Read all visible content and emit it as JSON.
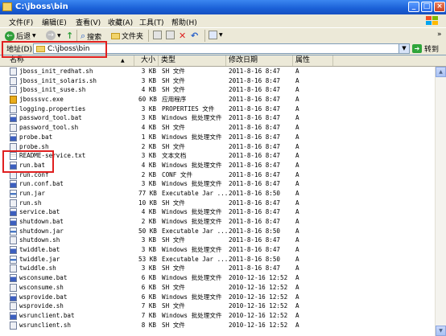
{
  "window": {
    "title": "C:\\jboss\\bin",
    "minimize_glyph": "_",
    "maximize_glyph": "□",
    "close_glyph": "×"
  },
  "menu": [
    "文件(F)",
    "编辑(E)",
    "查看(V)",
    "收藏(A)",
    "工具(T)",
    "帮助(H)"
  ],
  "toolbar": {
    "back": "后退",
    "search": "搜索",
    "folders": "文件夹",
    "forward_glyph": "»"
  },
  "address": {
    "label": "地址(D)",
    "value": "C:\\jboss\\bin",
    "go": "转到"
  },
  "columns": {
    "name": "名称",
    "name_sort_glyph": "▲",
    "size": "大小",
    "type": "类型",
    "modified": "修改日期",
    "attributes": "属性"
  },
  "files": [
    {
      "name": "jboss_init_redhat.sh",
      "size": "3 KB",
      "type": "SH 文件",
      "date": "2011-8-16 8:47",
      "attr": "A",
      "icon": "sh"
    },
    {
      "name": "jboss_init_solaris.sh",
      "size": "3 KB",
      "type": "SH 文件",
      "date": "2011-8-16 8:47",
      "attr": "A",
      "icon": "sh"
    },
    {
      "name": "jboss_init_suse.sh",
      "size": "4 KB",
      "type": "SH 文件",
      "date": "2011-8-16 8:47",
      "attr": "A",
      "icon": "sh"
    },
    {
      "name": "jbosssvc.exe",
      "size": "60 KB",
      "type": "应用程序",
      "date": "2011-8-16 8:47",
      "attr": "A",
      "icon": "exe"
    },
    {
      "name": "logging.properties",
      "size": "3 KB",
      "type": "PROPERTIES 文件",
      "date": "2011-8-16 8:47",
      "attr": "A",
      "icon": "sh"
    },
    {
      "name": "password_tool.bat",
      "size": "3 KB",
      "type": "Windows 批处理文件",
      "date": "2011-8-16 8:47",
      "attr": "A",
      "icon": "bat"
    },
    {
      "name": "password_tool.sh",
      "size": "4 KB",
      "type": "SH 文件",
      "date": "2011-8-16 8:47",
      "attr": "A",
      "icon": "sh"
    },
    {
      "name": "probe.bat",
      "size": "1 KB",
      "type": "Windows 批处理文件",
      "date": "2011-8-16 8:47",
      "attr": "A",
      "icon": "bat"
    },
    {
      "name": "probe.sh",
      "size": "2 KB",
      "type": "SH 文件",
      "date": "2011-8-16 8:47",
      "attr": "A",
      "icon": "sh"
    },
    {
      "name": "README-service.txt",
      "size": "3 KB",
      "type": "文本文档",
      "date": "2011-8-16 8:47",
      "attr": "A",
      "icon": "txt"
    },
    {
      "name": "run.bat",
      "size": "4 KB",
      "type": "Windows 批处理文件",
      "date": "2011-8-16 8:47",
      "attr": "A",
      "icon": "bat"
    },
    {
      "name": "run.conf",
      "size": "2 KB",
      "type": "CONF 文件",
      "date": "2011-8-16 8:47",
      "attr": "A",
      "icon": "sh"
    },
    {
      "name": "run.conf.bat",
      "size": "3 KB",
      "type": "Windows 批处理文件",
      "date": "2011-8-16 8:47",
      "attr": "A",
      "icon": "bat"
    },
    {
      "name": "run.jar",
      "size": "77 KB",
      "type": "Executable Jar ...",
      "date": "2011-8-16 8:50",
      "attr": "A",
      "icon": "jar"
    },
    {
      "name": "run.sh",
      "size": "10 KB",
      "type": "SH 文件",
      "date": "2011-8-16 8:47",
      "attr": "A",
      "icon": "sh"
    },
    {
      "name": "service.bat",
      "size": "4 KB",
      "type": "Windows 批处理文件",
      "date": "2011-8-16 8:47",
      "attr": "A",
      "icon": "bat"
    },
    {
      "name": "shutdown.bat",
      "size": "2 KB",
      "type": "Windows 批处理文件",
      "date": "2011-8-16 8:47",
      "attr": "A",
      "icon": "bat"
    },
    {
      "name": "shutdown.jar",
      "size": "50 KB",
      "type": "Executable Jar ...",
      "date": "2011-8-16 8:50",
      "attr": "A",
      "icon": "jar"
    },
    {
      "name": "shutdown.sh",
      "size": "3 KB",
      "type": "SH 文件",
      "date": "2011-8-16 8:47",
      "attr": "A",
      "icon": "sh"
    },
    {
      "name": "twiddle.bat",
      "size": "3 KB",
      "type": "Windows 批处理文件",
      "date": "2011-8-16 8:47",
      "attr": "A",
      "icon": "bat"
    },
    {
      "name": "twiddle.jar",
      "size": "53 KB",
      "type": "Executable Jar ...",
      "date": "2011-8-16 8:50",
      "attr": "A",
      "icon": "jar"
    },
    {
      "name": "twiddle.sh",
      "size": "3 KB",
      "type": "SH 文件",
      "date": "2011-8-16 8:47",
      "attr": "A",
      "icon": "sh"
    },
    {
      "name": "wsconsume.bat",
      "size": "6 KB",
      "type": "Windows 批处理文件",
      "date": "2010-12-16 12:52",
      "attr": "A",
      "icon": "bat"
    },
    {
      "name": "wsconsume.sh",
      "size": "6 KB",
      "type": "SH 文件",
      "date": "2010-12-16 12:52",
      "attr": "A",
      "icon": "sh"
    },
    {
      "name": "wsprovide.bat",
      "size": "6 KB",
      "type": "Windows 批处理文件",
      "date": "2010-12-16 12:52",
      "attr": "A",
      "icon": "bat"
    },
    {
      "name": "wsprovide.sh",
      "size": "7 KB",
      "type": "SH 文件",
      "date": "2010-12-16 12:52",
      "attr": "A",
      "icon": "sh"
    },
    {
      "name": "wsrunclient.bat",
      "size": "7 KB",
      "type": "Windows 批处理文件",
      "date": "2010-12-16 12:52",
      "attr": "A",
      "icon": "bat"
    },
    {
      "name": "wsrunclient.sh",
      "size": "8 KB",
      "type": "SH 文件",
      "date": "2010-12-16 12:52",
      "attr": "A",
      "icon": "sh"
    }
  ],
  "scrollbar": {
    "up_glyph": "▲",
    "down_glyph": "▼"
  },
  "colors": {
    "titlebar": "#1a5fd6",
    "chrome": "#ece9d8",
    "highlight": "#e02020"
  }
}
